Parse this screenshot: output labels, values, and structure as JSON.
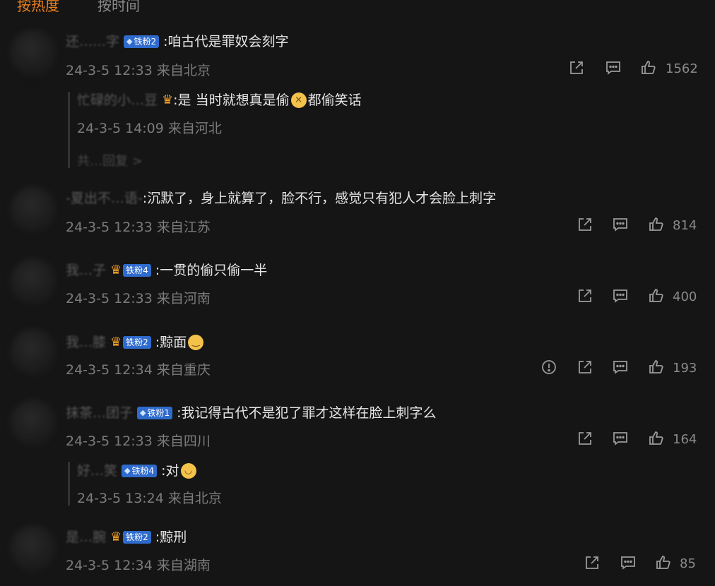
{
  "tabs": {
    "hot": "按热度",
    "time": "按时间"
  },
  "comments": [
    {
      "user": "还……字",
      "badge": "铁粉2",
      "text": ":咱古代是罪奴会刻字",
      "meta": "24-3-5 12:33 来自北京",
      "likes": "1562"
    },
    {
      "reply_user": "忙碌的小…豆",
      "reply_text_a": ":是 当时就想真是偷",
      "reply_text_b": "都偷笑话",
      "reply_meta": "24-3-5 14:09 来自河北",
      "more": "共…回复 >"
    },
    {
      "user": "-夏出不…语-",
      "text": ":沉默了，身上就算了，脸不行，感觉只有犯人才会脸上刺字",
      "meta": "24-3-5 12:33 来自江苏",
      "likes": "814"
    },
    {
      "user": "我…子",
      "badge": "铁粉4",
      "text": ":一贯的偷只偷一半",
      "meta": "24-3-5 12:33 来自河南",
      "likes": "400"
    },
    {
      "user": "我…膝",
      "badge": "铁粉2",
      "text": ":黥面",
      "meta": "24-3-5 12:34 来自重庆",
      "likes": "193"
    },
    {
      "user": "抹茶…团子",
      "badge": "铁粉1",
      "text": ":我记得古代不是犯了罪才这样在脸上刺字么",
      "meta": "24-3-5 12:33 来自四川",
      "likes": "164",
      "reply_user": "好…笑",
      "reply_badge": "铁粉4",
      "reply_text": ":对",
      "reply_meta": "24-3-5 13:24 来自北京"
    },
    {
      "user": "是…腕",
      "badge": "铁粉2",
      "text": ":黥刑",
      "meta": "24-3-5 12:34 来自湖南",
      "likes": "85"
    }
  ],
  "icons": {
    "share": "share-icon",
    "comment": "comment-icon",
    "like": "like-icon",
    "report": "report-icon"
  },
  "colors": {
    "bg": "#151515",
    "accent": "#e8801f",
    "badge": "#2f6bcc"
  }
}
